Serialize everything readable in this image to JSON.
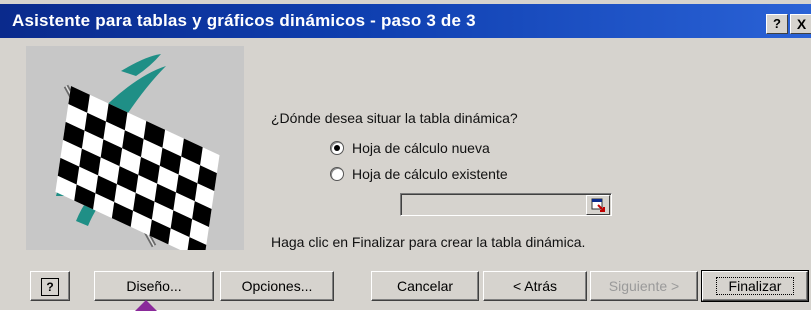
{
  "window": {
    "title": "Asistente para tablas y gráficos dinámicos - paso 3 de 3",
    "help_label": "?",
    "close_label": "X"
  },
  "main": {
    "question": "¿Dónde desea situar la tabla dinámica?",
    "options": [
      {
        "label": "Hoja de cálculo nueva",
        "checked": true
      },
      {
        "label": "Hoja de cálculo existente",
        "checked": false
      }
    ],
    "range_value": "",
    "info": "Haga clic en Finalizar para crear la tabla dinámica."
  },
  "buttons": {
    "help": "?",
    "design": "Diseño...",
    "options": "Opciones...",
    "cancel": "Cancelar",
    "back": "< Atrás",
    "next": "Siguiente >",
    "finish": "Finalizar"
  },
  "colors": {
    "title_bar": "#0a2a8c",
    "dialog_bg": "#d6d3ce",
    "pointer_arrow": "#8a2a9a"
  }
}
